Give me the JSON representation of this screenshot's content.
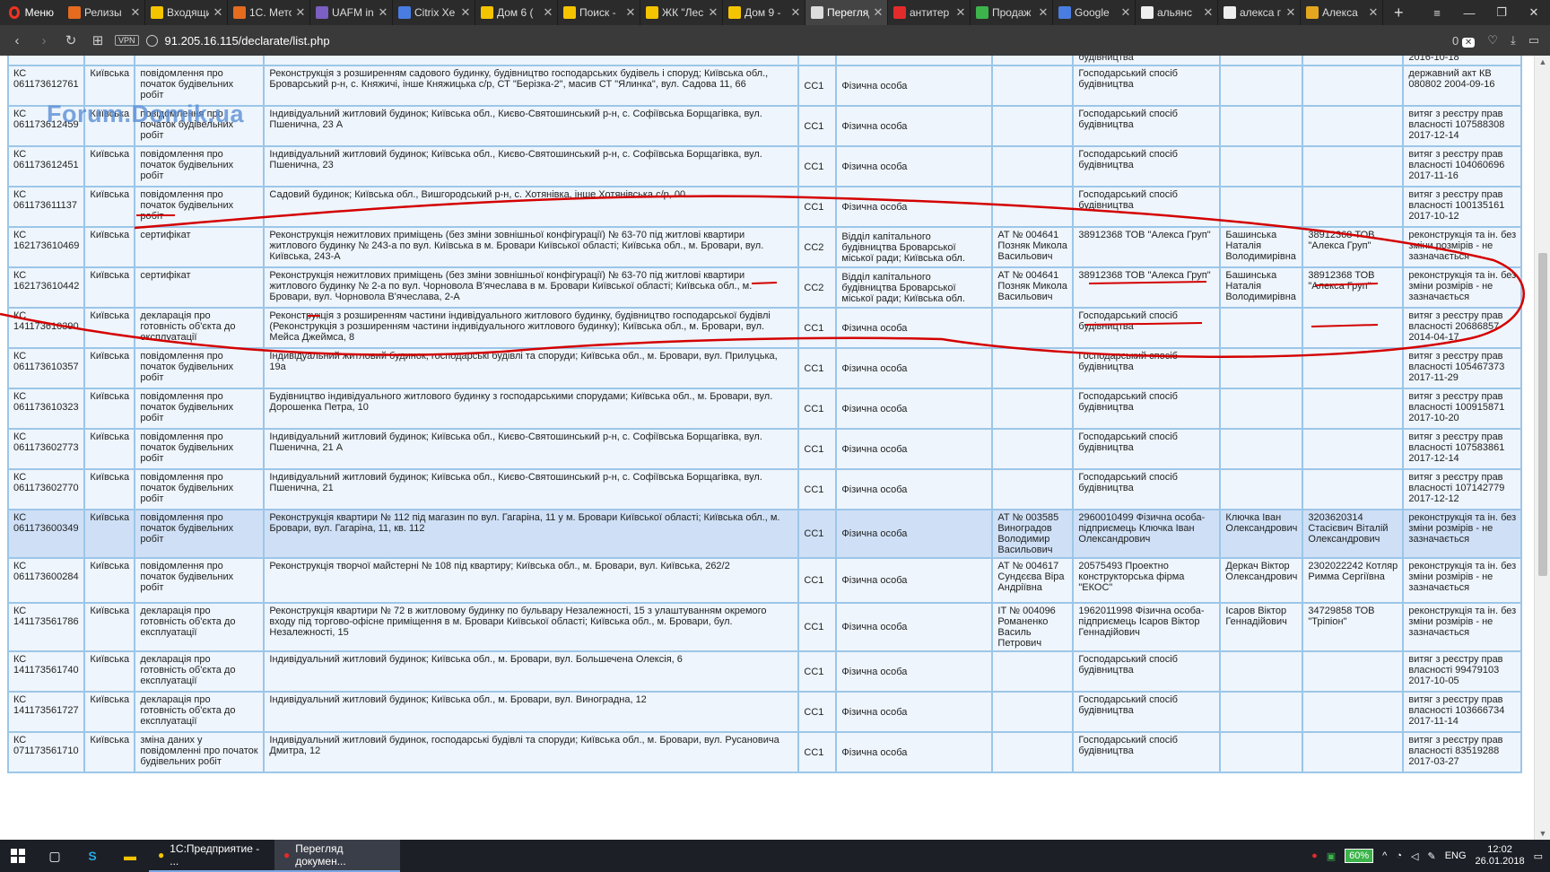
{
  "browser": {
    "menu_label": "Меню",
    "tabs": [
      {
        "label": "Релизы",
        "color": "#e56b1f"
      },
      {
        "label": "Входящие",
        "color": "#f5c400"
      },
      {
        "label": "1С. Мето",
        "color": "#e56b1f"
      },
      {
        "label": "UAFM in",
        "color": "#7b5fc2"
      },
      {
        "label": "Citrix Xe",
        "color": "#4a7de2"
      },
      {
        "label": "Дом 6 (",
        "color": "#f5c400"
      },
      {
        "label": "Поиск -",
        "color": "#f5c400"
      },
      {
        "label": "ЖК \"Лес",
        "color": "#f5c400"
      },
      {
        "label": "Дом 9 -",
        "color": "#f5c400"
      },
      {
        "label": "Перегляд",
        "color": "#dddddd"
      },
      {
        "label": "антитер",
        "color": "#e32b2b"
      },
      {
        "label": "Продаж",
        "color": "#3cb44b"
      },
      {
        "label": "Google",
        "color": "#4a7de2"
      },
      {
        "label": "альянс",
        "color": "#eeeeee"
      },
      {
        "label": "алекса г",
        "color": "#eeeeee"
      },
      {
        "label": "Алекса",
        "color": "#e5a61f"
      }
    ],
    "active_tab_index": 9,
    "url": "91.205.16.115/declarate/list.php",
    "vpn_label": "VPN",
    "badge_count": "0"
  },
  "watermark": "Forum.Domik.ua",
  "table": {
    "partial_top_row": {
      "code": "",
      "developer": "будівництва",
      "land": "2016-10-18"
    },
    "rows": [
      {
        "code": "КС 061173612761",
        "region": "Київська",
        "type": "повідомлення про початок будівельних робіт",
        "object": "Реконструкція з розширенням садового будинку, будівництво господарських будівель і споруд; Київська обл., Броварський р-н, с. Княжичі, інше Княжицька с/р, СТ \"Берізка-2\", масив СТ \"Ялинка\", вул. Садова 11, 66",
        "cls": "СС1",
        "customer": "Фізична особа",
        "license": "",
        "developer": "Господарський спосіб будівництва",
        "tech": "",
        "author": "",
        "land": "державний акт КВ 080802 2004-09-16",
        "hl": false
      },
      {
        "code": "КС 061173612459",
        "region": "Київська",
        "type": "повідомлення про початок будівельних робіт",
        "object": "Індивідуальний житловий будинок; Київська обл., Києво-Святошинський р-н, с. Софіївська Борщагівка, вул. Пшенична, 23 А",
        "cls": "СС1",
        "customer": "Фізична особа",
        "license": "",
        "developer": "Господарський спосіб будівництва",
        "tech": "",
        "author": "",
        "land": "витяг з реєстру прав власності 107588308 2017-12-14",
        "hl": false
      },
      {
        "code": "КС 061173612451",
        "region": "Київська",
        "type": "повідомлення про початок будівельних робіт",
        "object": "Індивідуальний житловий будинок; Київська обл., Києво-Святошинський р-н, с. Софіївська Борщагівка, вул. Пшенична, 23",
        "cls": "СС1",
        "customer": "Фізична особа",
        "license": "",
        "developer": "Господарський спосіб будівництва",
        "tech": "",
        "author": "",
        "land": "витяг з реєстру прав власності 104060696 2017-11-16",
        "hl": false
      },
      {
        "code": "КС 061173611137",
        "region": "Київська",
        "type": "повідомлення про початок будівельних робіт",
        "object": "Садовий будинок; Київська обл., Вишгородський р-н, с. Хотянівка, інше Хотянівська с/р, 00",
        "cls": "СС1",
        "customer": "Фізична особа",
        "license": "",
        "developer": "Господарський спосіб будівництва",
        "tech": "",
        "author": "",
        "land": "витяг з реєстру прав власності 100135161 2017-10-12",
        "hl": false
      },
      {
        "code": "КС 162173610469",
        "region": "Київська",
        "type": "сертифікат",
        "object": "Реконструкція нежитлових приміщень (без зміни зовнішньої конфігурації) № 63-70 під житлові квартири житлового будинку № 243-а по вул. Київська в м. Бровари Київської області; Київська обл., м. Бровари, вул. Київська, 243-А",
        "cls": "СС2",
        "customer": "Відділ капітального будівництва Броварської міської ради; Київська обл.",
        "license": "АТ № 004641 Позняк Микола Васильович",
        "developer": "38912368 ТОВ \"Алекса Груп\"",
        "tech": "Башинська Наталія Володимирівна",
        "author": "38912368 ТОВ \"Алекса Груп\"",
        "land": "реконструкція та ін. без зміни розмірів - не зазначається",
        "hl": false
      },
      {
        "code": "КС 162173610442",
        "region": "Київська",
        "type": "сертифікат",
        "object": "Реконструкція нежитлових приміщень (без зміни зовнішньої конфігурації) № 63-70 під житлові квартири житлового будинку № 2-а по вул. Чорновола В'ячеслава в м. Бровари Київської області; Київська обл., м. Бровари, вул. Чорновола В'ячеслава, 2-А",
        "cls": "СС2",
        "customer": "Відділ капітального будівництва Броварської міської ради; Київська обл.",
        "license": "АТ № 004641 Позняк Микола Васильович",
        "developer": "38912368 ТОВ \"Алекса Груп\"",
        "tech": "Башинська Наталія Володимирівна",
        "author": "38912368 ТОВ \"Алекса Груп\"",
        "land": "реконструкція та ін. без зміни розмірів - не зазначається",
        "hl": false
      },
      {
        "code": "КС 141173610390",
        "region": "Київська",
        "type": "декларація про готовність об'єкта до експлуатації",
        "object": "Реконструкція з розширенням частини індивідуального житлового будинку, будівництво господарської будівлі (Реконструкція з розширенням частини індивідуального житлового будинку); Київська обл., м. Бровари, вул. Мейса Джеймса, 8",
        "cls": "СС1",
        "customer": "Фізична особа",
        "license": "",
        "developer": "Господарський спосіб будівництва",
        "tech": "",
        "author": "",
        "land": "витяг з реєстру прав власності 20686857 2014-04-17",
        "hl": false
      },
      {
        "code": "КС 061173610357",
        "region": "Київська",
        "type": "повідомлення про початок будівельних робіт",
        "object": "Індивідуальний житловий будинок, господарські будівлі та споруди; Київська обл., м. Бровари, вул. Прилуцька, 19а",
        "cls": "СС1",
        "customer": "Фізична особа",
        "license": "",
        "developer": "Господарський спосіб будівництва",
        "tech": "",
        "author": "",
        "land": "витяг з реєстру прав власності 105467373 2017-11-29",
        "hl": false
      },
      {
        "code": "КС 061173610323",
        "region": "Київська",
        "type": "повідомлення про початок будівельних робіт",
        "object": "Будівництво індивідуального житлового будинку з господарськими спорудами; Київська обл., м. Бровари, вул. Дорошенка Петра, 10",
        "cls": "СС1",
        "customer": "Фізична особа",
        "license": "",
        "developer": "Господарський спосіб будівництва",
        "tech": "",
        "author": "",
        "land": "витяг з реєстру прав власності 100915871 2017-10-20",
        "hl": false
      },
      {
        "code": "КС 061173602773",
        "region": "Київська",
        "type": "повідомлення про початок будівельних робіт",
        "object": "Індивідуальний житловий будинок; Київська обл., Києво-Святошинський р-н, с. Софіївська Борщагівка, вул. Пшенична, 21 А",
        "cls": "СС1",
        "customer": "Фізична особа",
        "license": "",
        "developer": "Господарський спосіб будівництва",
        "tech": "",
        "author": "",
        "land": "витяг з реєстру прав власності 107583861 2017-12-14",
        "hl": false
      },
      {
        "code": "КС 061173602770",
        "region": "Київська",
        "type": "повідомлення про початок будівельних робіт",
        "object": "Індивідуальний житловий будинок; Київська обл., Києво-Святошинський р-н, с. Софіївська Борщагівка, вул. Пшенична, 21",
        "cls": "СС1",
        "customer": "Фізична особа",
        "license": "",
        "developer": "Господарський спосіб будівництва",
        "tech": "",
        "author": "",
        "land": "витяг з реєстру прав власності 107142779 2017-12-12",
        "hl": false
      },
      {
        "code": "КС 061173600349",
        "region": "Київська",
        "type": "повідомлення про початок будівельних робіт",
        "object": "Реконструкція квартири № 112 під магазин по вул. Гагаріна, 11 у м. Бровари Київської області; Київська обл., м. Бровари, вул. Гагаріна, 11, кв. 112",
        "cls": "СС1",
        "customer": "Фізична особа",
        "license": "АТ № 003585 Виноградов Володимир Васильович",
        "developer": "2960010499 Фізична особа-підприємець Ключка Іван Олександрович",
        "tech": "Ключка Іван Олександрович",
        "author": "3203620314 Стасієвич Віталій Олександрович",
        "land": "реконструкція та ін. без зміни розмірів - не зазначається",
        "hl": true
      },
      {
        "code": "КС 061173600284",
        "region": "Київська",
        "type": "повідомлення про початок будівельних робіт",
        "object": "Реконструкція творчої майстерні № 108 під квартиру; Київська обл., м. Бровари, вул. Київська, 262/2",
        "cls": "СС1",
        "customer": "Фізична особа",
        "license": "АТ № 004617 Сундєєва Віра Андріївна",
        "developer": "20575493 Проектно конструкторська фірма \"ЕКОС\"",
        "tech": "Деркач Віктор Олександрович",
        "author": "2302022242 Котляр Римма Сергіївна",
        "land": "реконструкція та ін. без зміни розмірів - не зазначається",
        "hl": false
      },
      {
        "code": "КС 141173561786",
        "region": "Київська",
        "type": "декларація про готовність об'єкта до експлуатації",
        "object": "Реконструкція квартири № 72 в житловому будинку по бульвару Незалежності, 15 з улаштуванням окремого входу під торгово-офісне приміщення в м. Бровари Київської області; Київська обл., м. Бровари, бул. Незалежності, 15",
        "cls": "СС1",
        "customer": "Фізична особа",
        "license": "ІТ № 004096 Романенко Василь Петрович",
        "developer": "1962011998 Фізична особа-підприємець Ісаров Віктор Геннадійович",
        "tech": "Ісаров Віктор Геннадійович",
        "author": "34729858 ТОВ \"Тріпіон\"",
        "land": "реконструкція та ін. без зміни розмірів - не зазначається",
        "hl": false
      },
      {
        "code": "КС 141173561740",
        "region": "Київська",
        "type": "декларація про готовність об'єкта до експлуатації",
        "object": "Індивідуальний житловий будинок; Київська обл., м. Бровари, вул. Большечена Олексія, 6",
        "cls": "СС1",
        "customer": "Фізична особа",
        "license": "",
        "developer": "Господарський спосіб будівництва",
        "tech": "",
        "author": "",
        "land": "витяг з реєстру прав власності 99479103 2017-10-05",
        "hl": false
      },
      {
        "code": "КС 141173561727",
        "region": "Київська",
        "type": "декларація про готовність об'єкта до експлуатації",
        "object": "Індивідуальний житловий будинок; Київська обл., м. Бровари, вул. Виноградна, 12",
        "cls": "СС1",
        "customer": "Фізична особа",
        "license": "",
        "developer": "Господарський спосіб будівництва",
        "tech": "",
        "author": "",
        "land": "витяг з реєстру прав власності 103666734 2017-11-14",
        "hl": false
      },
      {
        "code": "КС 071173561710",
        "region": "Київська",
        "type": "зміна даних у повідомленні про початок будівельних робіт",
        "object": "Індивідуальний житловий будинок, господарські будівлі та споруди; Київська обл., м. Бровари, вул. Русановича Дмитра, 12",
        "cls": "СС1",
        "customer": "Фізична особа",
        "license": "",
        "developer": "Господарський спосіб будівництва",
        "tech": "",
        "author": "",
        "land": "витяг з реєстру прав власності 83519288 2017-03-27",
        "hl": false
      }
    ]
  },
  "taskbar": {
    "apps": [
      {
        "label": "1С:Предприятие - ...",
        "active": false
      },
      {
        "label": "Перегляд докумен...",
        "active": true
      }
    ],
    "battery": "60%",
    "lang": "ENG",
    "time": "12:02",
    "date": "26.01.2018"
  },
  "colors": {
    "annotation": "#d40000",
    "table_border": "#9cc6e8",
    "row_bg": "#eef5fc",
    "row_highlight": "#cfe0f6"
  }
}
